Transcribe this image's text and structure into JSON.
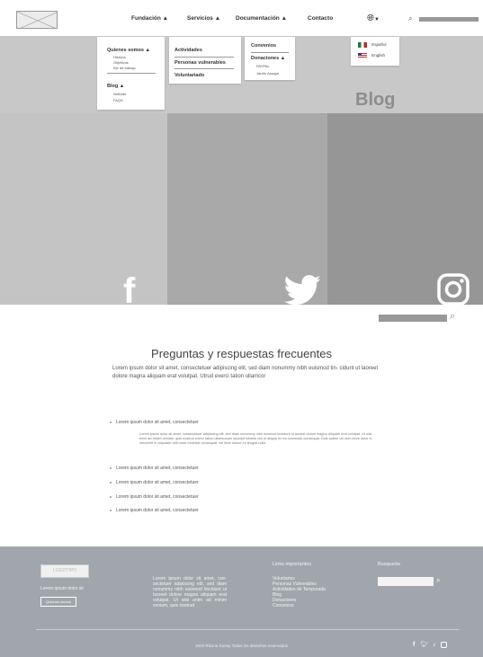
{
  "nav": {
    "items": [
      {
        "label": "Fundación"
      },
      {
        "label": "Servicios"
      },
      {
        "label": "Documentación"
      },
      {
        "label": "Contacto"
      }
    ]
  },
  "fundacion_menu": {
    "heading1": "Quienes somos",
    "subitems1": [
      "Historia",
      "Objetivos",
      "Eje de trabajo"
    ],
    "heading2": "Blog",
    "subitems2": [
      "Noticias",
      "FAQS"
    ]
  },
  "servicios_menu": {
    "items": [
      "Actividades",
      "Personas vulnerables",
      "Voluntariado"
    ]
  },
  "documentacion_menu": {
    "convenios": "Convenios",
    "donaciones": "Donaciones",
    "subitems": [
      "PAYPAL",
      "Jardín Assaye"
    ]
  },
  "language_menu": {
    "items": [
      "Español",
      "English"
    ]
  },
  "hero": {
    "title": "Blog"
  },
  "faq": {
    "title": "Preguntas y respuestas frecuentes",
    "intro": "Lorem ipsum dolor sit amet, consectetuer adipiscing elit, sed diam nonummy nibh euismod tin- cidunt ut laoreet dolore magna aliquam erat volutpat. Utrud exerci tation ullamcor",
    "questions": [
      "Lorem ipsum dolor sit amet, consectetuer",
      "Lorem ipsum dolor sit amet, consectetuer",
      "Lorem ipsum dolor sit amet, consectetuer",
      "Lorem ipsum dolor sit amet, consectetuer",
      "Lorem ipsum dolor sit amet, consectetuer"
    ],
    "answer": "Lorem ipsum dolor sit amet, consectetuer adipiscing elit, sed diam nonummy nibh euismod tincidunt ut laoreet dolore magna aliquam erat volutpat. Ut wisi enim ad minim veniam, quis nostrud exerci tation ullamcorper suscipit lobortis nisl ut aliquip ex ea commodo consequat. Duis autem vel eum iriure dolor in hendrerit in vulputate velit esse molestie consequat, vel illum dolore eu feugiat nulla"
  },
  "footer": {
    "logo": "LOGOTIPO",
    "tagline": "Lorem ipsum dolor sit",
    "button": "Quienes somos",
    "text": "Lorem ipsum dolor sit amet, con- sectetuer adipiscing elit, sed diam nonummy nibh euismod tincidunt ut laoreet dolore magna aliquam erat volutpat. Ut wisi enim ad minim veniam, quis nostrud",
    "links_title": "Links importantes",
    "links": [
      "Voluntarios",
      "Personas Vulnerables",
      "Actividades de Temporada",
      "Blog",
      "Donaciones",
      "Convenios"
    ],
    "search_title": "Busqueda",
    "copyright": "2022 Rikuna Kunay Todos los derechos reservados"
  },
  "colors": {
    "hero": "#c8c8c8",
    "panel_left": "#c4c4c4",
    "panel_mid": "#a9a9a9",
    "panel_right": "#969696",
    "footer": "#a0a6ab"
  }
}
